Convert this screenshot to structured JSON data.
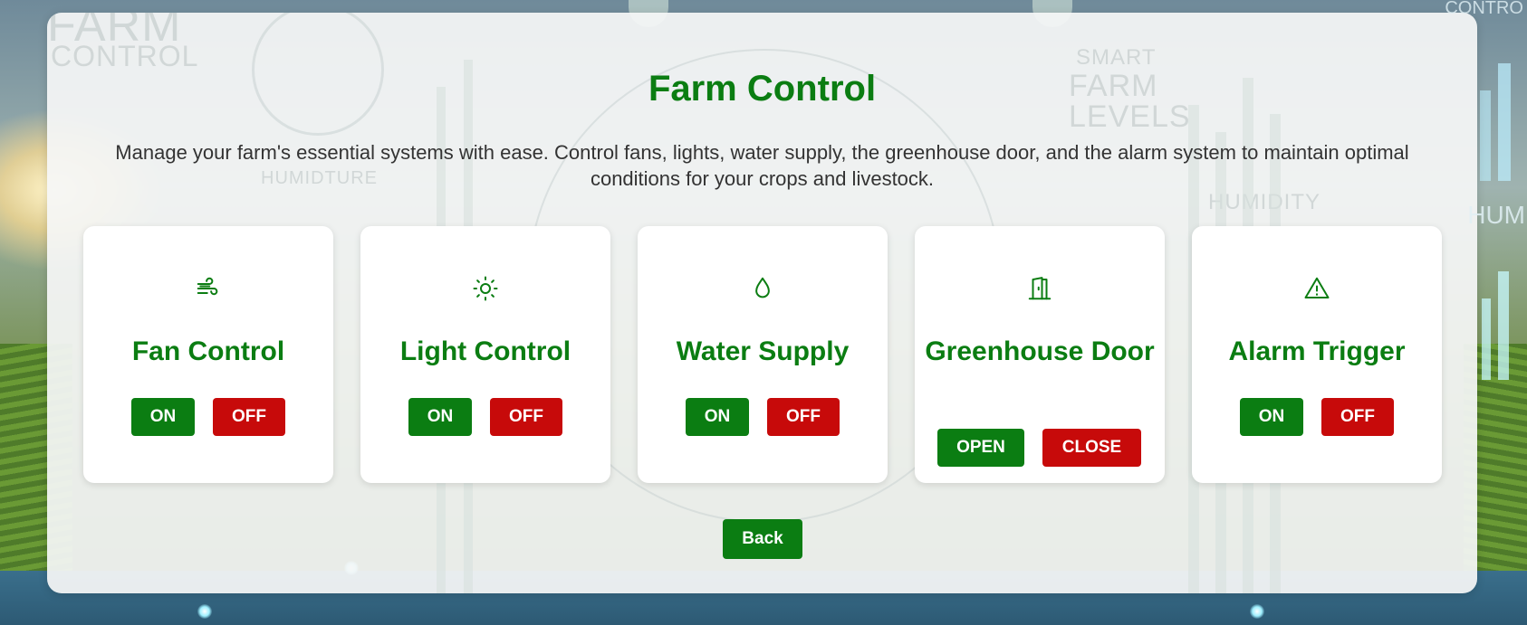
{
  "page": {
    "title": "Farm Control",
    "description": "Manage your farm's essential systems with ease. Control fans, lights, water supply, the greenhouse door, and the alarm system to maintain optimal conditions for your crops and livestock."
  },
  "background_text": {
    "farm": "FARM",
    "control": "CONTROL",
    "humidture": "HUMIDTURE",
    "smart": "SMART",
    "farm2": "FARM",
    "levels": "LEVELS",
    "humidity": "HUMIDITY",
    "control_right": "CONTRO",
    "hum_right": "HUM"
  },
  "cards": [
    {
      "title": "Fan Control",
      "icon": "fan-wind-icon",
      "on_label": "ON",
      "off_label": "OFF"
    },
    {
      "title": "Light Control",
      "icon": "sun-icon",
      "on_label": "ON",
      "off_label": "OFF"
    },
    {
      "title": "Water Supply",
      "icon": "water-drop-icon",
      "on_label": "ON",
      "off_label": "OFF"
    },
    {
      "title": "Greenhouse Door",
      "icon": "door-icon",
      "on_label": "OPEN",
      "off_label": "CLOSE"
    },
    {
      "title": "Alarm Trigger",
      "icon": "warning-icon",
      "on_label": "ON",
      "off_label": "OFF"
    }
  ],
  "back_label": "Back",
  "colors": {
    "primary_green": "#0b7d12",
    "danger_red": "#c70a0a",
    "panel_bg": "#f5f6f6",
    "text": "#333333"
  }
}
